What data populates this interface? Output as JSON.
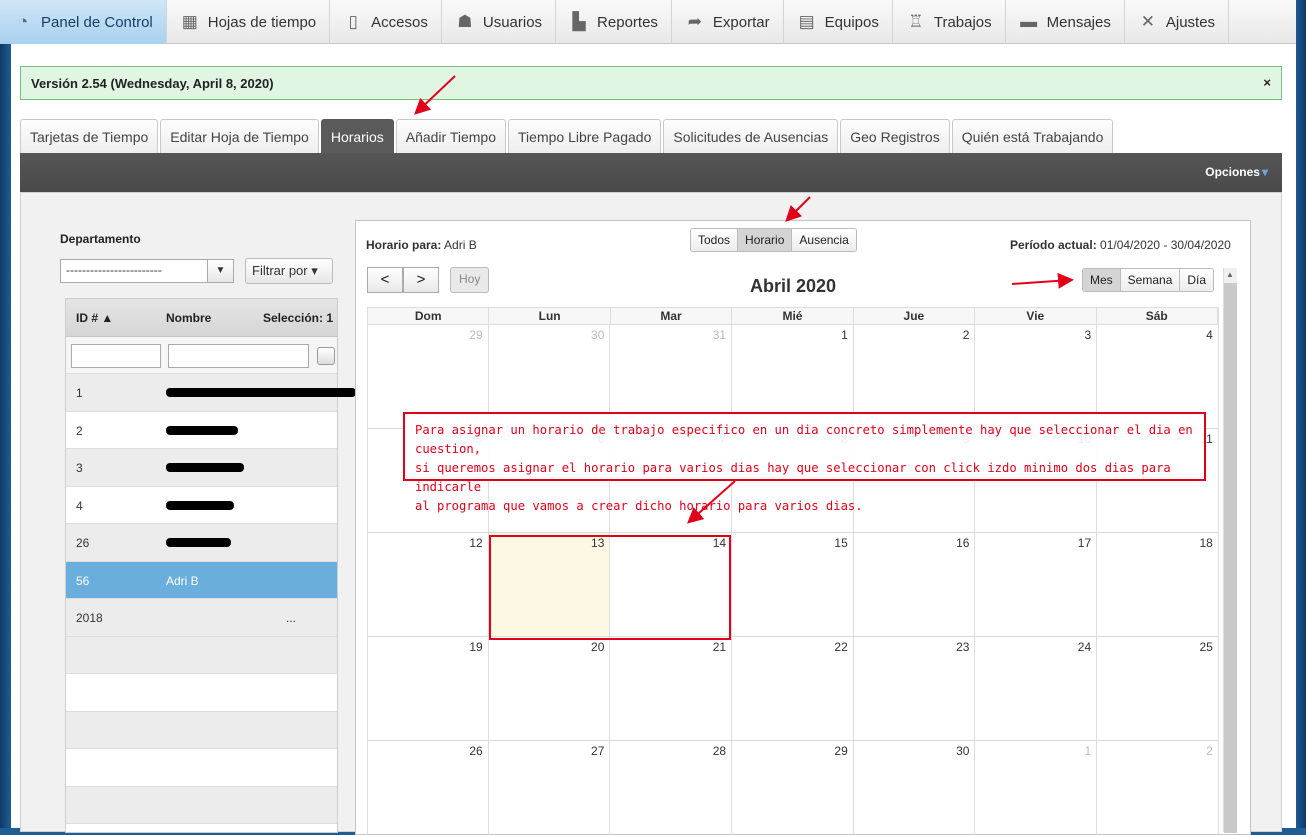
{
  "nav": {
    "items": [
      {
        "label": "Panel de Control",
        "icon": "dashboard-icon",
        "glyph": "◔",
        "active": true
      },
      {
        "label": "Hojas de tiempo",
        "icon": "calendar-icon",
        "glyph": "▦",
        "active": false
      },
      {
        "label": "Accesos",
        "icon": "door-icon",
        "glyph": "▯",
        "active": false
      },
      {
        "label": "Usuarios",
        "icon": "user-icon",
        "glyph": "☗",
        "active": false
      },
      {
        "label": "Reportes",
        "icon": "bar-chart-icon",
        "glyph": "▙",
        "active": false
      },
      {
        "label": "Exportar",
        "icon": "export-icon",
        "glyph": "➦",
        "active": false
      },
      {
        "label": "Equipos",
        "icon": "team-icon",
        "glyph": "▤",
        "active": false
      },
      {
        "label": "Trabajos",
        "icon": "worker-icon",
        "glyph": "♖",
        "active": false
      },
      {
        "label": "Mensajes",
        "icon": "chat-icon",
        "glyph": "▬",
        "active": false
      },
      {
        "label": "Ajustes",
        "icon": "tools-icon",
        "glyph": "✕",
        "active": false
      }
    ]
  },
  "alert": {
    "text": "Versión 2.54 (Wednesday, April 8, 2020)",
    "close": "×"
  },
  "tabs": [
    {
      "label": "Tarjetas de Tiempo",
      "active": false
    },
    {
      "label": "Editar Hoja de Tiempo",
      "active": false
    },
    {
      "label": "Horarios",
      "active": true
    },
    {
      "label": "Añadir Tiempo",
      "active": false
    },
    {
      "label": "Tiempo Libre Pagado",
      "active": false
    },
    {
      "label": "Solicitudes de Ausencias",
      "active": false
    },
    {
      "label": "Geo Registros",
      "active": false
    },
    {
      "label": "Quién está Trabajando",
      "active": false
    }
  ],
  "toolbar": {
    "options_label": "Opciones",
    "options_caret": "▾"
  },
  "left": {
    "dept_label": "Departamento",
    "dept_value": "------------------------",
    "dept_caret": "▼",
    "filter_label": "Filtrar por ▾",
    "headers": {
      "id": "ID # ▲",
      "name": "Nombre",
      "select": "Selección: 1"
    },
    "rows": [
      {
        "id": "1",
        "name": "",
        "redacted": true
      },
      {
        "id": "2",
        "name": "",
        "redacted": true
      },
      {
        "id": "3",
        "name": "",
        "redacted": true
      },
      {
        "id": "4",
        "name": "",
        "redacted": true
      },
      {
        "id": "26",
        "name": "",
        "redacted": true
      },
      {
        "id": "56",
        "name": "Adri B",
        "redacted": false,
        "selected": true
      },
      {
        "id": "2018",
        "name": "...",
        "redacted": true
      }
    ]
  },
  "calendar": {
    "schedule_for_label": "Horario para:",
    "schedule_for_value": "Adri B",
    "types": [
      "Todos",
      "Horario",
      "Ausencia"
    ],
    "active_type": "Horario",
    "period_label": "Período actual:",
    "period_value": "01/04/2020 - 30/04/2020",
    "prev": "<",
    "next": ">",
    "today_label": "Hoy",
    "month_title": "Abril 2020",
    "views": [
      "Mes",
      "Semana",
      "Día"
    ],
    "active_view": "Mes",
    "scroll_up": "▲",
    "weekdays": [
      "Dom",
      "Lun",
      "Mar",
      "Mié",
      "Jue",
      "Vie",
      "Sáb"
    ],
    "weeks": [
      [
        {
          "d": "29",
          "o": true
        },
        {
          "d": "30",
          "o": true
        },
        {
          "d": "31",
          "o": true
        },
        {
          "d": "1"
        },
        {
          "d": "2"
        },
        {
          "d": "3"
        },
        {
          "d": "4"
        }
      ],
      [
        {
          "d": "5"
        },
        {
          "d": "6"
        },
        {
          "d": "7"
        },
        {
          "d": "8"
        },
        {
          "d": "9"
        },
        {
          "d": "10"
        },
        {
          "d": "11"
        }
      ],
      [
        {
          "d": "12"
        },
        {
          "d": "13",
          "today": true
        },
        {
          "d": "14"
        },
        {
          "d": "15"
        },
        {
          "d": "16"
        },
        {
          "d": "17"
        },
        {
          "d": "18"
        }
      ],
      [
        {
          "d": "19"
        },
        {
          "d": "20"
        },
        {
          "d": "21"
        },
        {
          "d": "22"
        },
        {
          "d": "23"
        },
        {
          "d": "24"
        },
        {
          "d": "25"
        }
      ],
      [
        {
          "d": "26"
        },
        {
          "d": "27"
        },
        {
          "d": "28"
        },
        {
          "d": "29"
        },
        {
          "d": "30"
        },
        {
          "d": "1",
          "o": true
        },
        {
          "d": "2",
          "o": true
        }
      ]
    ]
  },
  "annotation": {
    "lines": [
      "Para asignar un horario de trabajo especifico en un dia concreto simplemente hay que seleccionar el dia en cuestion,",
      "si queremos asignar el horario para varios dias hay que seleccionar con click izdo minimo dos dias para indicarle",
      "al programa que vamos a crear dicho horario para varios dias."
    ],
    "color": "#e0001a"
  }
}
